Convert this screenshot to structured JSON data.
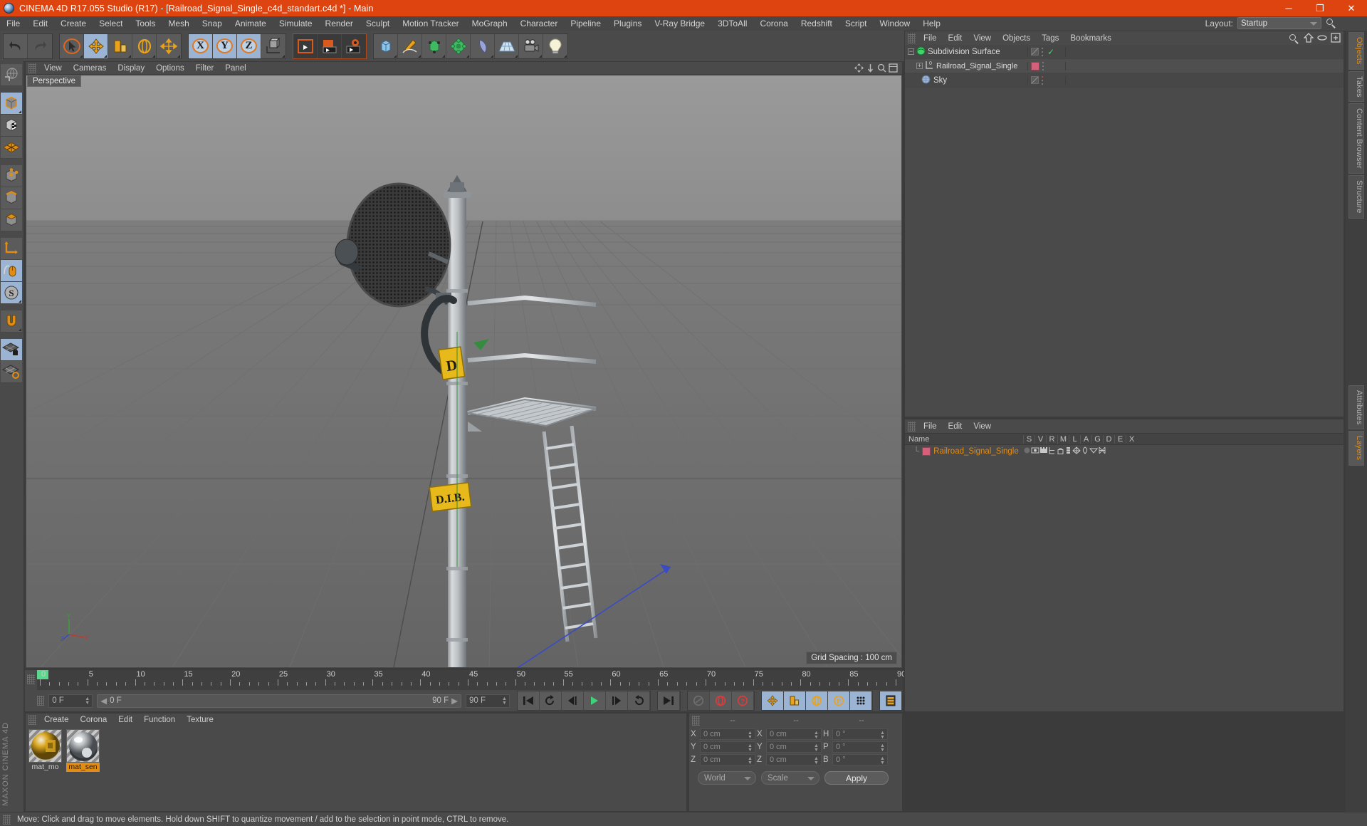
{
  "titlebar": {
    "title": "CINEMA 4D R17.055 Studio (R17) - [Railroad_Signal_Single_c4d_standart.c4d *] - Main",
    "minimize": "─",
    "maximize": "❐",
    "close": "✕"
  },
  "menubar": {
    "items": [
      {
        "label": "File"
      },
      {
        "label": "Edit"
      },
      {
        "label": "Create"
      },
      {
        "label": "Select"
      },
      {
        "label": "Tools"
      },
      {
        "label": "Mesh"
      },
      {
        "label": "Snap"
      },
      {
        "label": "Animate"
      },
      {
        "label": "Simulate"
      },
      {
        "label": "Render"
      },
      {
        "label": "Sculpt"
      },
      {
        "label": "Motion Tracker"
      },
      {
        "label": "MoGraph"
      },
      {
        "label": "Character"
      },
      {
        "label": "Pipeline"
      },
      {
        "label": "Plugins"
      },
      {
        "label": "V-Ray Bridge"
      },
      {
        "label": "3DToAll"
      },
      {
        "label": "Corona"
      },
      {
        "label": "Redshift"
      },
      {
        "label": "Script"
      },
      {
        "label": "Window"
      },
      {
        "label": "Help"
      }
    ],
    "layout_label": "Layout:",
    "layout_value": "Startup"
  },
  "viewport": {
    "menu": [
      "View",
      "Cameras",
      "Display",
      "Options",
      "Filter",
      "Panel"
    ],
    "tab_label": "Perspective",
    "grid_spacing": "Grid Spacing : 100 cm",
    "axis_x": "X",
    "axis_y": "Y",
    "axis_z": "Z"
  },
  "timeline": {
    "ticks": [
      {
        "label": "0",
        "value": 0
      },
      {
        "label": "5",
        "value": 5
      },
      {
        "label": "10",
        "value": 10
      },
      {
        "label": "15",
        "value": 15
      },
      {
        "label": "20",
        "value": 20
      },
      {
        "label": "25",
        "value": 25
      },
      {
        "label": "30",
        "value": 30
      },
      {
        "label": "35",
        "value": 35
      },
      {
        "label": "40",
        "value": 40
      },
      {
        "label": "45",
        "value": 45
      },
      {
        "label": "50",
        "value": 50
      },
      {
        "label": "55",
        "value": 55
      },
      {
        "label": "60",
        "value": 60
      },
      {
        "label": "65",
        "value": 65
      },
      {
        "label": "70",
        "value": 70
      },
      {
        "label": "75",
        "value": 75
      },
      {
        "label": "80",
        "value": 80
      },
      {
        "label": "85",
        "value": 85
      },
      {
        "label": "90",
        "value": 90
      }
    ],
    "range_min": 0,
    "range_max": 90,
    "current_frame": "0 F",
    "range_start": "0 F",
    "range_end": "90 F",
    "preview_end": "90 F",
    "preview_start": "0 F"
  },
  "material_manager": {
    "menu": [
      "Create",
      "Corona",
      "Edit",
      "Function",
      "Texture"
    ],
    "materials": [
      {
        "name": "mat_mo",
        "selected": false,
        "color_a": "#d8a520",
        "color_b": "#cfcfcf"
      },
      {
        "name": "mat_sen",
        "selected": true,
        "color_a": "#e7e7e7",
        "color_b": "#3a3a3a"
      }
    ]
  },
  "coordinates": {
    "headers": [
      "--",
      "--",
      "--"
    ],
    "rows": [
      {
        "l1": "X",
        "v1": "0 cm",
        "l2": "X",
        "v2": "0 cm",
        "l3": "H",
        "v3": "0 °"
      },
      {
        "l1": "Y",
        "v1": "0 cm",
        "l2": "Y",
        "v2": "0 cm",
        "l3": "P",
        "v3": "0 °"
      },
      {
        "l1": "Z",
        "v1": "0 cm",
        "l2": "Z",
        "v2": "0 cm",
        "l3": "B",
        "v3": "0 °"
      }
    ],
    "world_label": "World",
    "scale_label": "Scale",
    "apply_label": "Apply"
  },
  "object_manager": {
    "menu": [
      "File",
      "Edit",
      "View",
      "Objects",
      "Tags",
      "Bookmarks"
    ],
    "objects": [
      {
        "name": "Subdivision Surface",
        "depth": 0,
        "icon": "subdivision-surface-icon",
        "expander": "minus",
        "has_check": true,
        "has_mat": false
      },
      {
        "name": "Railroad_Signal_Single",
        "depth": 1,
        "icon": "null-object-icon",
        "expander": "plus",
        "has_check": false,
        "has_mat": true
      },
      {
        "name": "Sky",
        "depth": 0,
        "icon": "sky-icon",
        "expander": "none",
        "has_check": false,
        "has_mat": false
      }
    ]
  },
  "layer_manager": {
    "menu": [
      "File",
      "Edit",
      "View"
    ],
    "columns": [
      "Name",
      "S",
      "V",
      "R",
      "M",
      "L",
      "A",
      "G",
      "D",
      "E",
      "X"
    ],
    "rows": [
      {
        "name": "Railroad_Signal_Single",
        "color": "#d4607a"
      }
    ]
  },
  "vertical_tabs_top": [
    {
      "label": "Objects",
      "active": true
    },
    {
      "label": "Takes",
      "active": false
    },
    {
      "label": "Content Browser",
      "active": false
    },
    {
      "label": "Structure",
      "active": false
    }
  ],
  "vertical_tabs_bottom": [
    {
      "label": "Attributes",
      "active": false
    },
    {
      "label": "Layers",
      "active": true
    }
  ],
  "statusbar": {
    "message": "Move: Click and drag to move elements. Hold down SHIFT to quantize movement / add to the selection in point mode, CTRL to remove."
  },
  "toolbar": {
    "groups": [
      {
        "buttons": [
          {
            "name": "undo-icon",
            "label": "",
            "state": "normal"
          },
          {
            "name": "redo-icon",
            "label": "",
            "state": "disabled"
          }
        ]
      },
      {
        "buttons": [
          {
            "name": "live-selection-icon",
            "label": "",
            "state": "normal"
          },
          {
            "name": "move-tool-icon",
            "label": "",
            "state": "active"
          },
          {
            "name": "scale-tool-icon",
            "label": "",
            "state": "normal"
          },
          {
            "name": "rotate-tool-icon",
            "label": "",
            "state": "normal"
          },
          {
            "name": "move-axis-icon",
            "label": "",
            "state": "normal"
          }
        ]
      },
      {
        "buttons": [
          {
            "name": "axis-x-toggle",
            "label": "X",
            "state": "active"
          },
          {
            "name": "axis-y-toggle",
            "label": "Y",
            "state": "active"
          },
          {
            "name": "axis-z-toggle",
            "label": "Z",
            "state": "active"
          },
          {
            "name": "world-coordinate-toggle",
            "label": "",
            "state": "normal"
          }
        ]
      },
      {
        "buttons": [
          {
            "name": "render-view-icon",
            "label": "",
            "state": "dark"
          },
          {
            "name": "render-region-icon",
            "label": "",
            "state": "dark"
          },
          {
            "name": "render-settings-icon",
            "label": "",
            "state": "dark"
          }
        ]
      },
      {
        "buttons": [
          {
            "name": "cube-primitive-icon",
            "label": "",
            "state": "normal"
          },
          {
            "name": "spline-pen-icon",
            "label": "",
            "state": "normal"
          },
          {
            "name": "generator-icon",
            "label": "",
            "state": "normal"
          },
          {
            "name": "deformer-icon",
            "label": "",
            "state": "normal"
          },
          {
            "name": "environment-icon",
            "label": "",
            "state": "normal"
          },
          {
            "name": "floor-icon",
            "label": "",
            "state": "normal"
          },
          {
            "name": "camera-icon",
            "label": "",
            "state": "normal"
          },
          {
            "name": "light-icon",
            "label": "",
            "state": "normal"
          }
        ]
      }
    ]
  },
  "left_toolbar": {
    "buttons": [
      {
        "name": "undo-view-icon",
        "state": "normal",
        "gap": false
      },
      {
        "name": "model-mode-icon",
        "state": "active",
        "gap": true
      },
      {
        "name": "texture-mode-icon",
        "state": "normal",
        "gap": false
      },
      {
        "name": "polygon-grid-icon",
        "state": "normal",
        "gap": false
      },
      {
        "name": "point-mode-icon",
        "state": "normal",
        "gap": true
      },
      {
        "name": "edge-mode-icon",
        "state": "normal",
        "gap": false
      },
      {
        "name": "polygon-mode-icon",
        "state": "normal",
        "gap": false
      },
      {
        "name": "axis-modify-icon",
        "state": "normal",
        "gap": true
      },
      {
        "name": "viewport-solo-icon",
        "state": "active",
        "gap": false
      },
      {
        "name": "soft-selection-icon",
        "state": "active",
        "gap": false
      },
      {
        "name": "magnet-tool-icon",
        "state": "normal",
        "gap": true
      },
      {
        "name": "lock-workplane-icon",
        "state": "active",
        "gap": true
      },
      {
        "name": "workplane-icon",
        "state": "normal",
        "gap": false
      }
    ],
    "brand": "MAXON CINEMA 4D"
  }
}
